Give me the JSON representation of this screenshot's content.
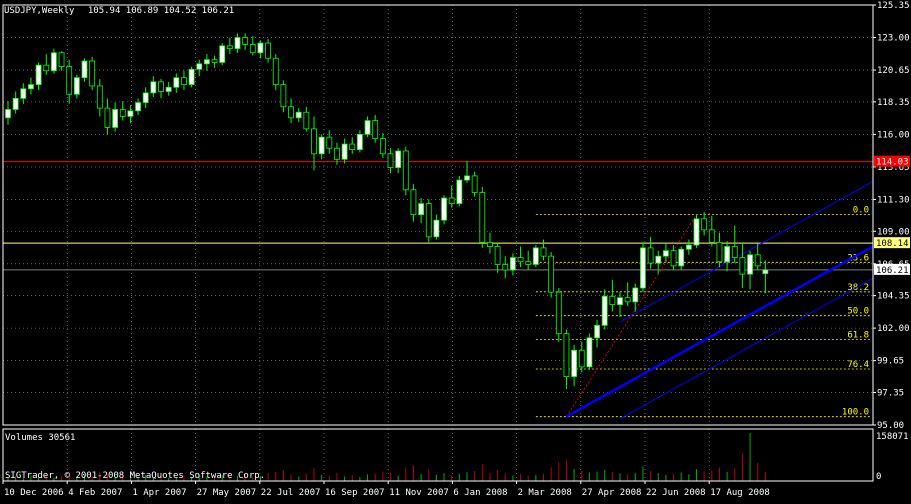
{
  "header": {
    "symbol_line": "USDJPY,Weekly",
    "ohlc_line": "105.94 106.89 104.52 106.21"
  },
  "volume_panel": {
    "label": "Volumes 30561",
    "max_label": "158071",
    "zero_label": "0",
    "max_value": 158071
  },
  "copyright": "SIGTrader, © 2001-2008 MetaQuotes Software Corp.",
  "colors": {
    "background": "#000000",
    "grid": "#9a9a9a",
    "axis": "#ffffff",
    "bull_candle": "#ffffff",
    "bear_candle": "#000000",
    "candle_outline": "#00ff00",
    "channel": "#0000ff",
    "fib": "#ffff00",
    "red_level": "#ff0000",
    "volume_up": "#00b000",
    "volume_down": "#c00000"
  },
  "chart_data": {
    "type": "candlestick",
    "title": "USDJPY,Weekly",
    "ylim": [
      95.0,
      125.35
    ],
    "y_ticks": [
      "125.35",
      "123.00",
      "120.65",
      "118.35",
      "116.00",
      "113.65",
      "111.30",
      "109.00",
      "106.65",
      "104.35",
      "102.00",
      "99.65",
      "97.35",
      "95.00"
    ],
    "x_labels": [
      "10 Dec 2006",
      "4 Feb 2007",
      "1 Apr 2007",
      "27 May 2007",
      "22 Jul 2007",
      "16 Sep 2007",
      "11 Nov 2007",
      "6 Jan 2008",
      "2 Mar 2008",
      "27 Apr 2008",
      "22 Jun 2008",
      "17 Aug 2008"
    ],
    "horizontal_levels": [
      {
        "value": 114.03,
        "label": "114.03",
        "color": "#ff0000"
      },
      {
        "value": 108.14,
        "label": "108.14",
        "color": "#ffff80"
      },
      {
        "value": 106.21,
        "label": "106.21",
        "color": "#808080"
      }
    ],
    "fibonacci": {
      "high": 110.2,
      "low": 95.6,
      "levels": [
        {
          "ratio": 0.0,
          "label": "0.0"
        },
        {
          "ratio": 0.236,
          "label": "23.6"
        },
        {
          "ratio": 0.382,
          "label": "38.2"
        },
        {
          "ratio": 0.5,
          "label": "50.0"
        },
        {
          "ratio": 0.618,
          "label": "61.8"
        },
        {
          "ratio": 0.764,
          "label": "76.4"
        },
        {
          "ratio": 1.0,
          "label": "100.0"
        }
      ]
    },
    "channel": {
      "start": {
        "week": 100,
        "price": 95.6
      },
      "slope_per_week": 0.307,
      "offset": 2.3
    },
    "candles": [
      [
        1,
        117.2,
        118.4,
        116.7,
        117.8
      ],
      [
        2,
        117.8,
        119.1,
        117.5,
        118.6
      ],
      [
        3,
        118.6,
        119.7,
        118.2,
        119.3
      ],
      [
        4,
        119.3,
        120.1,
        118.9,
        119.6
      ],
      [
        5,
        119.6,
        121.2,
        119.2,
        121.0
      ],
      [
        6,
        121.0,
        121.8,
        120.3,
        120.6
      ],
      [
        7,
        120.6,
        122.2,
        120.4,
        121.9
      ],
      [
        8,
        121.9,
        122.0,
        120.6,
        120.9
      ],
      [
        9,
        120.9,
        121.4,
        118.2,
        118.9
      ],
      [
        10,
        118.9,
        120.3,
        118.6,
        120.1
      ],
      [
        11,
        120.1,
        121.5,
        119.8,
        121.3
      ],
      [
        12,
        121.3,
        121.6,
        119.2,
        119.5
      ],
      [
        13,
        119.5,
        120.0,
        117.3,
        117.9
      ],
      [
        14,
        117.9,
        118.6,
        116.0,
        116.5
      ],
      [
        15,
        116.5,
        118.3,
        116.2,
        117.8
      ],
      [
        16,
        117.8,
        118.4,
        117.0,
        117.3
      ],
      [
        17,
        117.3,
        118.1,
        116.8,
        117.7
      ],
      [
        18,
        117.7,
        118.6,
        117.4,
        118.3
      ],
      [
        19,
        118.3,
        119.4,
        117.9,
        119.0
      ],
      [
        20,
        119.0,
        120.2,
        118.7,
        119.8
      ],
      [
        21,
        119.8,
        120.0,
        118.6,
        119.1
      ],
      [
        22,
        119.1,
        119.8,
        118.8,
        119.4
      ],
      [
        23,
        119.4,
        120.4,
        119.0,
        120.1
      ],
      [
        24,
        120.1,
        120.6,
        119.2,
        119.6
      ],
      [
        25,
        119.6,
        120.9,
        119.4,
        120.7
      ],
      [
        26,
        120.7,
        121.4,
        120.2,
        121.1
      ],
      [
        27,
        121.1,
        121.8,
        120.6,
        121.4
      ],
      [
        28,
        121.4,
        121.7,
        120.8,
        121.2
      ],
      [
        29,
        121.2,
        122.6,
        121.0,
        122.4
      ],
      [
        30,
        122.4,
        123.0,
        121.8,
        122.2
      ],
      [
        31,
        122.2,
        123.3,
        121.9,
        123.0
      ],
      [
        32,
        123.0,
        123.3,
        122.1,
        122.5
      ],
      [
        33,
        122.5,
        123.1,
        121.7,
        121.9
      ],
      [
        34,
        121.9,
        122.8,
        121.5,
        122.6
      ],
      [
        35,
        122.6,
        122.9,
        121.2,
        121.5
      ],
      [
        36,
        121.5,
        121.8,
        119.2,
        119.6
      ],
      [
        37,
        119.6,
        119.9,
        117.6,
        118.0
      ],
      [
        38,
        118.0,
        118.6,
        116.8,
        117.2
      ],
      [
        39,
        117.2,
        117.9,
        116.9,
        117.6
      ],
      [
        40,
        117.6,
        118.0,
        116.2,
        116.4
      ],
      [
        41,
        116.4,
        117.3,
        113.4,
        114.6
      ],
      [
        42,
        114.6,
        116.0,
        114.2,
        115.8
      ],
      [
        43,
        115.8,
        116.3,
        114.6,
        115.0
      ],
      [
        44,
        115.0,
        115.4,
        113.8,
        114.2
      ],
      [
        45,
        114.2,
        115.7,
        113.9,
        115.3
      ],
      [
        46,
        115.3,
        115.8,
        114.6,
        114.9
      ],
      [
        47,
        114.9,
        116.3,
        114.7,
        116.0
      ],
      [
        48,
        116.0,
        117.3,
        115.8,
        117.0
      ],
      [
        49,
        117.0,
        117.4,
        115.4,
        115.7
      ],
      [
        50,
        115.7,
        116.1,
        114.3,
        114.6
      ],
      [
        51,
        114.6,
        115.0,
        113.2,
        113.6
      ],
      [
        52,
        113.6,
        115.0,
        113.2,
        114.8
      ],
      [
        53,
        114.8,
        115.1,
        111.6,
        112.0
      ],
      [
        54,
        112.0,
        112.4,
        109.7,
        110.2
      ],
      [
        55,
        110.2,
        111.4,
        109.6,
        111.0
      ],
      [
        56,
        111.0,
        111.3,
        108.2,
        108.6
      ],
      [
        57,
        108.6,
        110.2,
        108.4,
        109.8
      ],
      [
        58,
        109.8,
        111.6,
        109.5,
        111.4
      ],
      [
        59,
        111.4,
        112.3,
        110.7,
        111.0
      ],
      [
        60,
        111.0,
        113.0,
        110.8,
        112.7
      ],
      [
        61,
        112.7,
        114.1,
        112.5,
        113.0
      ],
      [
        62,
        113.0,
        113.3,
        111.5,
        111.8
      ],
      [
        63,
        111.8,
        112.2,
        107.8,
        108.2
      ],
      [
        64,
        108.2,
        108.9,
        107.4,
        107.9
      ],
      [
        65,
        107.9,
        108.2,
        106.0,
        106.6
      ],
      [
        66,
        106.6,
        107.2,
        105.6,
        106.2
      ],
      [
        67,
        106.2,
        107.4,
        105.8,
        107.1
      ],
      [
        68,
        107.1,
        107.9,
        106.4,
        106.8
      ],
      [
        69,
        106.8,
        107.6,
        106.2,
        106.6
      ],
      [
        70,
        106.6,
        108.0,
        106.4,
        107.8
      ],
      [
        71,
        107.8,
        108.4,
        106.9,
        107.2
      ],
      [
        72,
        107.2,
        107.5,
        104.2,
        104.6
      ],
      [
        73,
        104.6,
        104.9,
        101.0,
        101.6
      ],
      [
        74,
        101.6,
        101.9,
        97.6,
        98.5
      ],
      [
        75,
        98.5,
        100.8,
        97.8,
        100.4
      ],
      [
        76,
        100.4,
        101.0,
        98.8,
        99.2
      ],
      [
        77,
        99.2,
        101.6,
        99.0,
        101.3
      ],
      [
        78,
        101.3,
        102.6,
        100.6,
        102.2
      ],
      [
        79,
        102.2,
        104.8,
        101.9,
        104.3
      ],
      [
        80,
        104.3,
        105.5,
        103.2,
        103.7
      ],
      [
        81,
        103.7,
        104.6,
        102.8,
        104.2
      ],
      [
        82,
        104.2,
        105.3,
        103.6,
        103.9
      ],
      [
        83,
        103.9,
        105.2,
        103.2,
        104.9
      ],
      [
        84,
        104.9,
        108.2,
        104.6,
        107.8
      ],
      [
        85,
        107.8,
        108.6,
        106.3,
        106.7
      ],
      [
        86,
        106.7,
        107.6,
        105.9,
        107.2
      ],
      [
        87,
        107.2,
        108.1,
        106.8,
        107.6
      ],
      [
        88,
        107.6,
        108.0,
        106.2,
        106.5
      ],
      [
        89,
        106.5,
        107.9,
        106.2,
        107.7
      ],
      [
        90,
        107.7,
        108.4,
        107.3,
        108.0
      ],
      [
        91,
        108.0,
        110.2,
        107.8,
        109.9
      ],
      [
        92,
        109.9,
        110.4,
        108.7,
        109.1
      ],
      [
        93,
        109.1,
        110.1,
        107.9,
        108.2
      ],
      [
        94,
        108.2,
        108.9,
        106.4,
        106.8
      ],
      [
        95,
        106.8,
        108.3,
        106.1,
        107.9
      ],
      [
        96,
        107.9,
        109.4,
        106.7,
        107.1
      ],
      [
        97,
        107.1,
        108.2,
        104.9,
        105.9
      ],
      [
        98,
        105.9,
        107.6,
        104.8,
        107.3
      ],
      [
        99,
        107.3,
        108.1,
        106.2,
        106.5
      ],
      [
        100,
        105.94,
        106.89,
        104.52,
        106.21
      ]
    ],
    "volumes": [
      [
        1,
        12000
      ],
      [
        2,
        15000
      ],
      [
        3,
        9000
      ],
      [
        4,
        18000
      ],
      [
        5,
        14000
      ],
      [
        6,
        21000
      ],
      [
        7,
        11000
      ],
      [
        8,
        16000
      ],
      [
        9,
        24000
      ],
      [
        10,
        13000
      ],
      [
        11,
        19000
      ],
      [
        12,
        15000
      ],
      [
        13,
        28000
      ],
      [
        14,
        22000
      ],
      [
        15,
        12000
      ],
      [
        16,
        17000
      ],
      [
        17,
        9000
      ],
      [
        18,
        14000
      ],
      [
        19,
        20000
      ],
      [
        20,
        11000
      ],
      [
        21,
        16000
      ],
      [
        22,
        10000
      ],
      [
        23,
        13000
      ],
      [
        24,
        18000
      ],
      [
        25,
        12000
      ],
      [
        26,
        21000
      ],
      [
        27,
        15000
      ],
      [
        28,
        11000
      ],
      [
        29,
        19000
      ],
      [
        30,
        14000
      ],
      [
        31,
        17000
      ],
      [
        32,
        23000
      ],
      [
        33,
        12000
      ],
      [
        34,
        16000
      ],
      [
        35,
        26000
      ],
      [
        36,
        30000
      ],
      [
        37,
        35000
      ],
      [
        38,
        22000
      ],
      [
        39,
        14000
      ],
      [
        40,
        25000
      ],
      [
        41,
        42000
      ],
      [
        42,
        20000
      ],
      [
        43,
        18000
      ],
      [
        44,
        27000
      ],
      [
        45,
        15000
      ],
      [
        46,
        19000
      ],
      [
        47,
        13000
      ],
      [
        48,
        22000
      ],
      [
        49,
        24000
      ],
      [
        50,
        31000
      ],
      [
        51,
        28000
      ],
      [
        52,
        18000
      ],
      [
        53,
        45000
      ],
      [
        54,
        52000
      ],
      [
        55,
        23000
      ],
      [
        56,
        38000
      ],
      [
        57,
        21000
      ],
      [
        58,
        26000
      ],
      [
        59,
        19000
      ],
      [
        60,
        24000
      ],
      [
        61,
        29000
      ],
      [
        62,
        33000
      ],
      [
        63,
        55000
      ],
      [
        64,
        27000
      ],
      [
        65,
        36000
      ],
      [
        66,
        25000
      ],
      [
        67,
        18000
      ],
      [
        68,
        22000
      ],
      [
        69,
        17000
      ],
      [
        70,
        20000
      ],
      [
        71,
        24000
      ],
      [
        72,
        46000
      ],
      [
        73,
        62000
      ],
      [
        74,
        70000
      ],
      [
        75,
        40000
      ],
      [
        76,
        34000
      ],
      [
        77,
        28000
      ],
      [
        78,
        31000
      ],
      [
        79,
        37000
      ],
      [
        80,
        29000
      ],
      [
        81,
        25000
      ],
      [
        82,
        22000
      ],
      [
        83,
        27000
      ],
      [
        84,
        48000
      ],
      [
        85,
        33000
      ],
      [
        86,
        26000
      ],
      [
        87,
        20000
      ],
      [
        88,
        24000
      ],
      [
        89,
        28000
      ],
      [
        90,
        22000
      ],
      [
        91,
        39000
      ],
      [
        92,
        31000
      ],
      [
        93,
        35000
      ],
      [
        94,
        44000
      ],
      [
        95,
        30000
      ],
      [
        96,
        42000
      ],
      [
        97,
        92000
      ],
      [
        98,
        158071
      ],
      [
        99,
        60000
      ],
      [
        100,
        30561
      ]
    ]
  }
}
